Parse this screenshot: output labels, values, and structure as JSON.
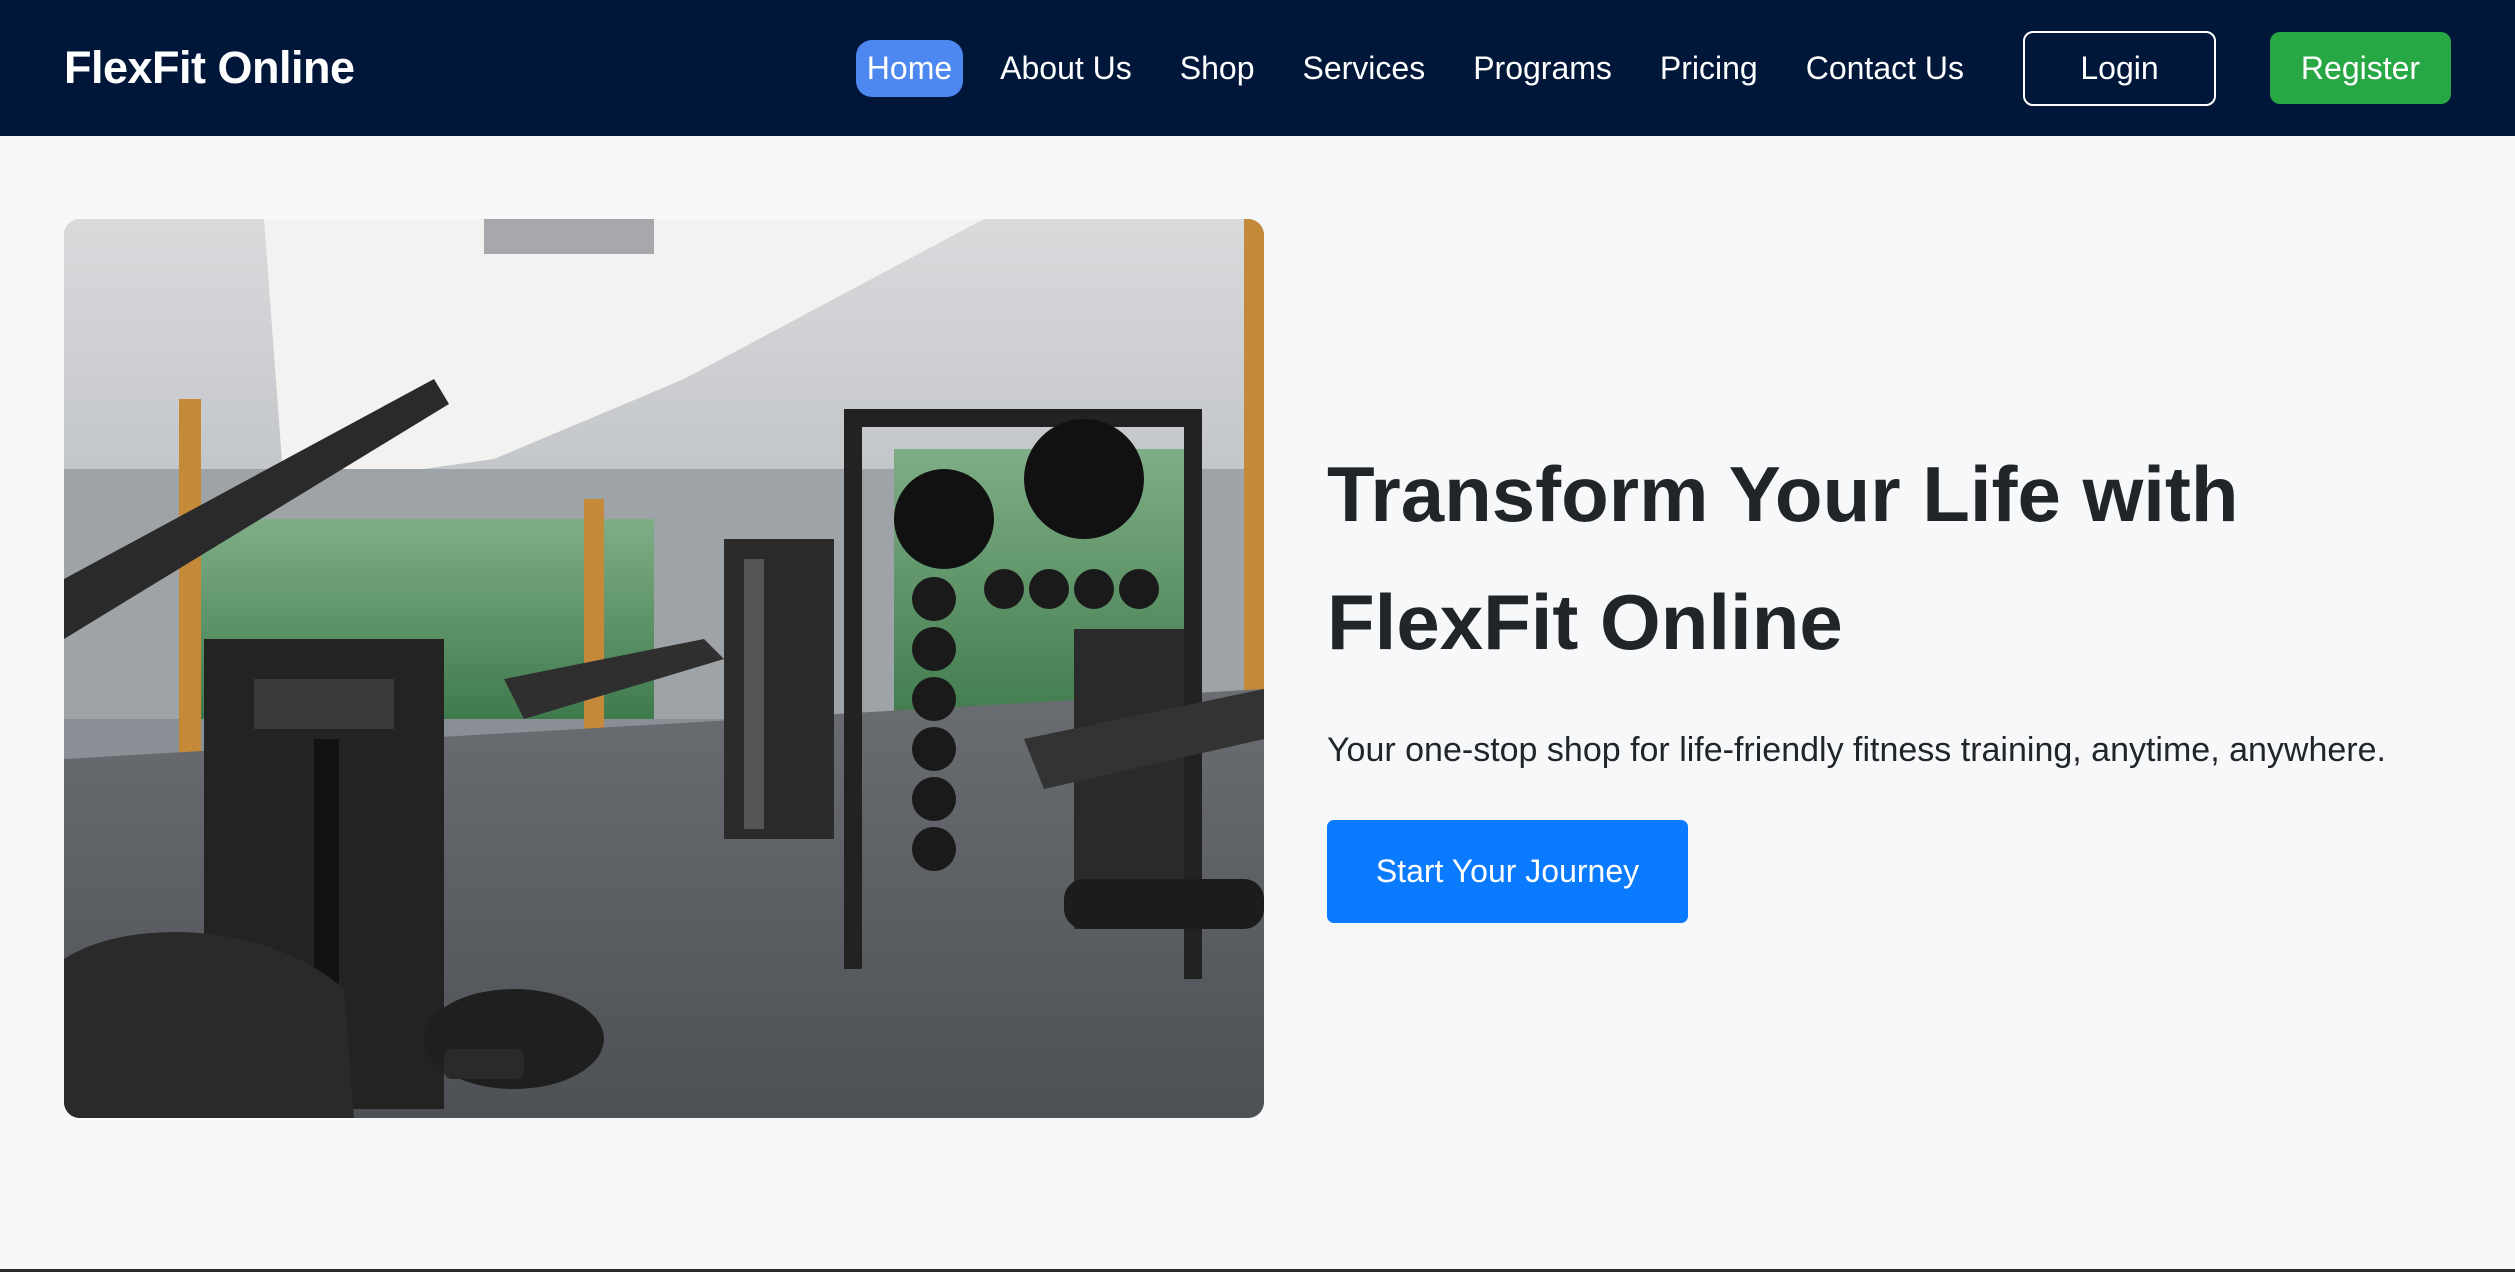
{
  "navbar": {
    "brand": "FlexFit Online",
    "links": [
      {
        "label": "Home",
        "active": true
      },
      {
        "label": "About Us"
      },
      {
        "label": "Shop"
      },
      {
        "label": "Services"
      },
      {
        "label": "Programs"
      },
      {
        "label": "Pricing"
      },
      {
        "label": "Contact Us"
      }
    ],
    "login_label": "Login",
    "register_label": "Register"
  },
  "hero": {
    "image_alt": "Gym interior with Precor strength machines and medicine ball rack",
    "title_line1": "Transform Your Life with",
    "title_line2": "FlexFit Online",
    "subtitle": "Your one-stop shop for life-friendly fitness training, anytime, anywhere.",
    "cta_label": "Start Your Journey"
  },
  "colors": {
    "navbar_bg": "#00173a",
    "active_link_bg": "#4d88f0",
    "register_bg": "#28a745",
    "cta_bg": "#0a7bff",
    "page_bg": "#f7f8fa"
  }
}
